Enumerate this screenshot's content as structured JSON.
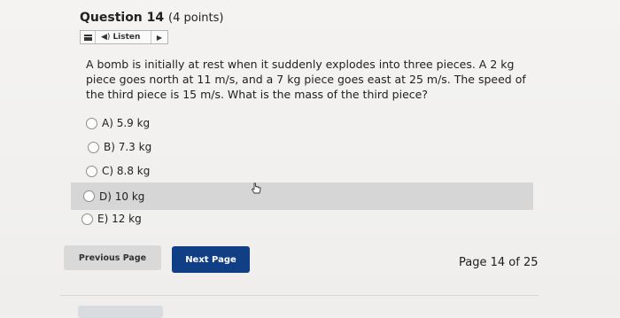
{
  "question": {
    "title": "Question 14",
    "points": "(4 points)",
    "text": "A bomb is initially at rest when it suddenly explodes into three pieces. A 2 kg piece goes north at 11 m/s, and a 7 kg piece goes east at 25 m/s. The speed of the third piece is 15 m/s. What is the mass of the third piece?"
  },
  "listen": {
    "label": "Listen",
    "menu_icon": "menu-icon",
    "speaker_icon": "speaker-icon",
    "play_icon": "play-icon"
  },
  "options": [
    {
      "label": "A) 5.9 kg"
    },
    {
      "label": "B) 7.3 kg"
    },
    {
      "label": "C) 8.8 kg"
    },
    {
      "label": "D) 10 kg"
    },
    {
      "label": "E) 12 kg"
    }
  ],
  "navigation": {
    "previous_label": "Previous Page",
    "next_label": "Next Page",
    "page_status": "Page 14 of 25"
  },
  "colors": {
    "next_button": "#103f86",
    "highlight_row": "#d6d6d6"
  }
}
